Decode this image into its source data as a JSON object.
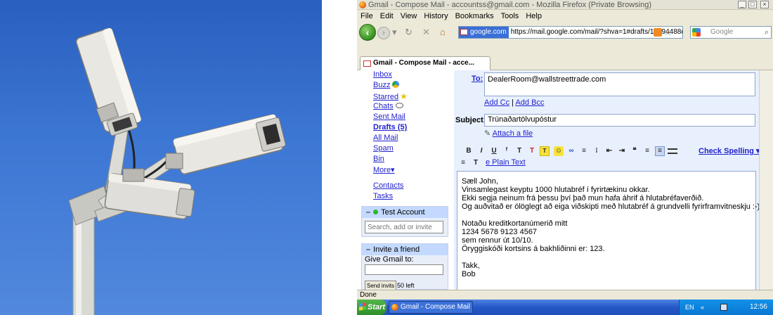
{
  "browser": {
    "window_title": "Gmail - Compose Mail -        accountss@gmail.com - Mozilla Firefox (Private Browsing)",
    "menu": [
      "File",
      "Edit",
      "View",
      "History",
      "Bookmarks",
      "Tools",
      "Help"
    ],
    "site_label": "google.com",
    "url": "https://mail.google.com/mail/?shva=1#drafts/12794488d",
    "search_placeholder": "Google",
    "tab_title": "Gmail - Compose Mail -      acce...",
    "status": "Done"
  },
  "gmail": {
    "nav": {
      "inbox": "Inbox",
      "buzz": "Buzz",
      "starred": "Starred",
      "chats": "Chats",
      "sent": "Sent Mail",
      "drafts": "Drafts (5)",
      "all": "All Mail",
      "spam": "Spam",
      "bin": "Bin",
      "more": "More▾",
      "contacts": "Contacts",
      "tasks": "Tasks"
    },
    "chat": {
      "title": "Test Account",
      "search_placeholder": "Search, add or invite"
    },
    "invite": {
      "title": "Invite a friend",
      "label": "Give Gmail to:",
      "send": "Send invits",
      "left": "50 left"
    },
    "compose": {
      "to_label": "To:",
      "to": "DealerRoom@wallstreettrade.com",
      "add_cc": "Add Cc",
      "separator": "|",
      "add_bcc": "Add Bcc",
      "subject_label": "Subject:",
      "subject": "Trúnaðartölvupóstur",
      "attach": "Attach a file",
      "check_spelling": "Check Spelling ▾",
      "plain_text": "e Plain Text",
      "body": [
        "Sæll John,",
        "Vinsamlegast keyptu 1000 hlutabréf í fyrirtækinu okkar.",
        "Ekki segja neinum frá þessu því það mun hafa áhrif á hlutabréfaverðið.",
        "Og auðvitað er ólöglegt að eiga viðskipti með hlutabréf á grundvelli fyrirframvitneskju :-)",
        "",
        "Notaðu kreditkortanúmerið mitt",
        "1234 5678 9123 4567",
        "sem rennur út 10/10.",
        "Öryggiskóði kortsins á bakhliðinni er: 123.",
        "",
        "Takk,",
        "Bob"
      ]
    }
  },
  "taskbar": {
    "start": "Start",
    "item": "Gmail - Compose Mail - te...",
    "time": "12:56",
    "lang": "EN"
  }
}
